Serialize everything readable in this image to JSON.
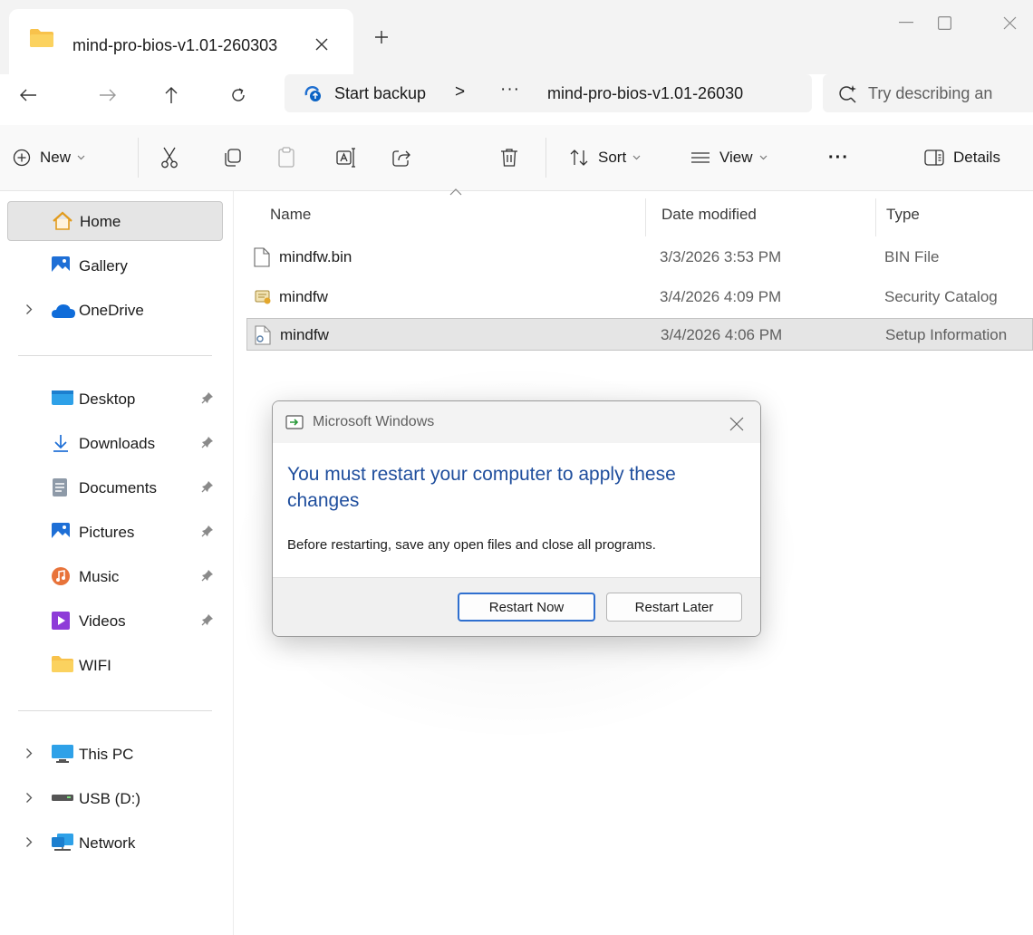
{
  "window": {
    "tab_title": "mind-pro-bios-v1.01-260303",
    "colors": {
      "folder": "#f8c24b",
      "accent": "#0067c0",
      "dialog_heading": "#1f4e9d"
    }
  },
  "address": {
    "backup_label": "Start backup",
    "separator": ">",
    "more": "···",
    "path": "mind-pro-bios-v1.01-26030",
    "search_placeholder": "Try describing an"
  },
  "commands": {
    "new": "New",
    "sort": "Sort",
    "view": "View",
    "more": "···",
    "details": "Details"
  },
  "sidebar": {
    "items": [
      {
        "label": "Home"
      },
      {
        "label": "Gallery"
      },
      {
        "label": "OneDrive"
      },
      {
        "label": "Desktop"
      },
      {
        "label": "Downloads"
      },
      {
        "label": "Documents"
      },
      {
        "label": "Pictures"
      },
      {
        "label": "Music"
      },
      {
        "label": "Videos"
      },
      {
        "label": "WIFI"
      },
      {
        "label": "This PC"
      },
      {
        "label": "USB (D:)"
      },
      {
        "label": "Network"
      }
    ]
  },
  "file_list": {
    "columns": {
      "name": "Name",
      "date": "Date modified",
      "type": "Type"
    },
    "rows": [
      {
        "name": "mindfw.bin",
        "date": "3/3/2026 3:53 PM",
        "type": "BIN File"
      },
      {
        "name": "mindfw",
        "date": "3/4/2026 4:09 PM",
        "type": "Security Catalog"
      },
      {
        "name": "mindfw",
        "date": "3/4/2026 4:06 PM",
        "type": "Setup Information"
      }
    ]
  },
  "dialog": {
    "title": "Microsoft Windows",
    "heading": "You must restart your computer to apply these changes",
    "body": "Before restarting, save any open files and close all programs.",
    "restart_now": "Restart Now",
    "restart_later": "Restart Later"
  }
}
